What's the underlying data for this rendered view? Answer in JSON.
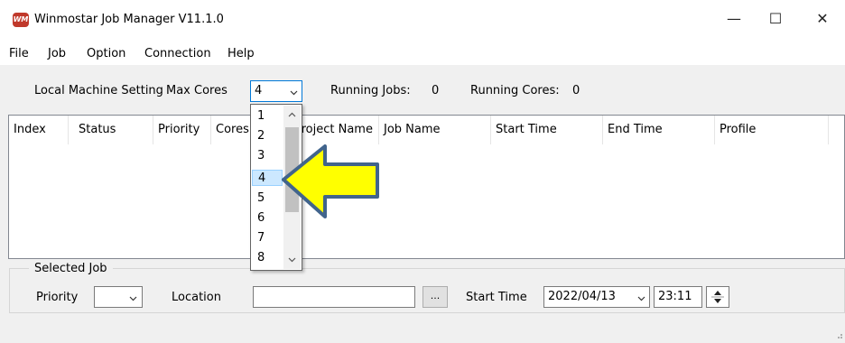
{
  "window": {
    "title": "Winmostar Job Manager V11.1.0",
    "icon_text": "WM",
    "minimize": "—",
    "maximize": "☐",
    "close": "✕"
  },
  "menu": [
    "File",
    "Job",
    "Option",
    "Connection",
    "Help"
  ],
  "toolbar": {
    "local_setting": "Local Machine Setting",
    "max_cores_label": "Max Cores",
    "max_cores_value": "4",
    "running_jobs_label": "Running Jobs:",
    "running_jobs_value": "0",
    "running_cores_label": "Running Cores:",
    "running_cores_value": "0"
  },
  "table": {
    "columns": [
      "Index",
      "Status",
      "Priority",
      "Cores",
      "Project Name",
      "Job Name",
      "Start Time",
      "End Time",
      "Profile"
    ],
    "rows": []
  },
  "dropdown": {
    "options": [
      "1",
      "2",
      "3",
      "4",
      "5",
      "6",
      "7",
      "8"
    ],
    "selected": "4"
  },
  "selected_job": {
    "group_label": "Selected Job",
    "priority_label": "Priority",
    "priority_value": "",
    "location_label": "Location",
    "location_value": "",
    "browse_label": "...",
    "start_time_label": "Start Time",
    "start_date": "2022/04/13",
    "start_clock": "23:11"
  },
  "colors": {
    "highlight_arrow": "#ffff00",
    "arrow_outline": "#41648c",
    "selection": "#cce8ff"
  }
}
